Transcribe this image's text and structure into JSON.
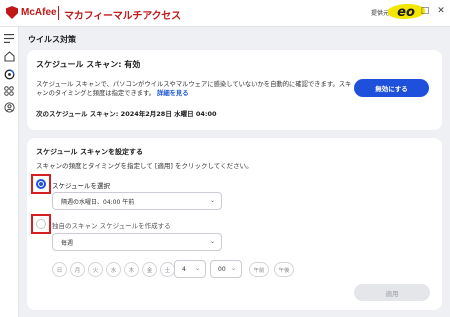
{
  "app": {
    "logo_text": "McAfee",
    "title": "マカフィーマルチアクセス",
    "provider_label": "提供元",
    "provider_logo_text": "eo",
    "window_controls": [
      "–",
      "□",
      "✕"
    ]
  },
  "sidebar": {
    "icons": [
      "menu-icon",
      "home-icon",
      "shield-scan-icon",
      "apps-icon",
      "account-icon"
    ]
  },
  "page": {
    "title": "ウイルス対策"
  },
  "status_card": {
    "title": "スケジュール スキャン: 有効",
    "description": "スケジュール スキャンで、パソコンがウイルスやマルウェアに感染していないかを自動的に確認できます。スキャンのタイミングと頻度は指定できます。",
    "details_link": "詳細を見る",
    "next_scan": "次のスケジュール スキャン: 2024年2月28日 水曜日 04:00",
    "disable_button": "無効にする"
  },
  "schedule_card": {
    "title": "スケジュール スキャンを設定する",
    "description": "スキャンの頻度とタイミングを指定して [適用] をクリックしてください。",
    "option_preset": {
      "label": "スケジュールを選択",
      "selected": true,
      "select_value": "隔週の水曜日、04:00 午前"
    },
    "option_custom": {
      "label": "独自のスキャン スケジュールを作成する",
      "selected": false,
      "select_value": "毎週"
    },
    "days": [
      "日",
      "月",
      "火",
      "水",
      "木",
      "金",
      "土"
    ],
    "hour": "4",
    "minute": "00",
    "am": "午前",
    "pm": "午後",
    "apply_button": "適用"
  },
  "colors": {
    "brand_red": "#c01818",
    "accent_blue": "#1e50dc",
    "highlight_red": "#d42020"
  }
}
